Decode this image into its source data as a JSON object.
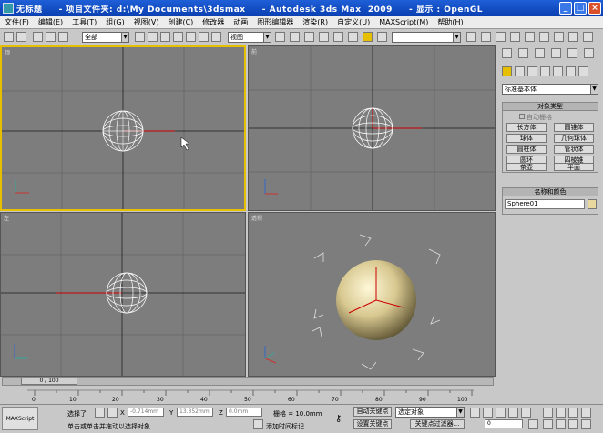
{
  "window": {
    "title": "无标题     - 项目文件夹: d:\\My Documents\\3dsmax     - Autodesk 3ds Max  2009     - 显示 : OpenGL"
  },
  "menu": [
    "文件(F)",
    "编辑(E)",
    "工具(T)",
    "组(G)",
    "视图(V)",
    "创建(C)",
    "修改器",
    "动画",
    "图形编辑器",
    "渲染(R)",
    "自定义(U)",
    "MAXScript(M)",
    "帮助(H)"
  ],
  "toolbar": {
    "selection_filter": "全部",
    "ref_coord": "视图",
    "named_selection": ""
  },
  "viewports": {
    "top_label": "顶",
    "front_label": "前",
    "left_label": "左",
    "persp_label": "透视"
  },
  "command_panel": {
    "category": "标准基本体",
    "object_type_title": "对象类型",
    "autogrid": "自动栅格",
    "buttons": [
      "长方体",
      "圆锥体",
      "球体",
      "几何球体",
      "圆柱体",
      "管状体",
      "圆环",
      "四棱锥",
      "茶壶",
      "平面"
    ],
    "name_color_title": "名称和颜色",
    "object_name": "Sphere01"
  },
  "timeline": {
    "frame": "0 / 100",
    "ticks": [
      "0",
      "10",
      "20",
      "30",
      "40",
      "50",
      "60",
      "70",
      "80",
      "90",
      "100"
    ]
  },
  "status": {
    "selection": "选择了",
    "prompt": "单击或单击并拖动以选择对象",
    "x_label": "X",
    "x_value": "-0.714mm",
    "y_label": "Y",
    "y_value": "13.352mm",
    "z_label": "Z",
    "z_value": "0.0mm",
    "grid": "栅格 = 10.0mm",
    "add_time_tag": "添加时间标记",
    "auto_key": "自动关键点",
    "set_key": "设置关键点",
    "key_filter_combo": "选定对象",
    "key_filters": "关键点过滤器...",
    "maxscript": "MAXScript",
    "frame_field": "0"
  },
  "colors": {
    "viewport_bg": "#7d7d7d",
    "active_border": "#e6c000",
    "title_bg": "#0a3fb0"
  }
}
